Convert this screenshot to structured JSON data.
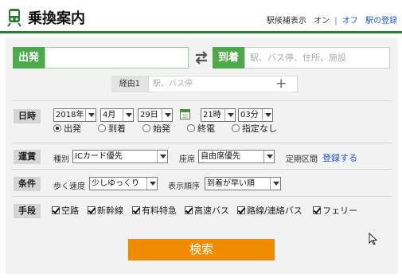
{
  "header": {
    "title": "乗換案内",
    "station_hint_label": "駅候補表示",
    "on_label": "オン",
    "separator": "|",
    "off_label": "オフ",
    "station_register_link": "駅の登録",
    "logo_icon": "train-icon",
    "accent_color": "#2e7d32"
  },
  "route": {
    "depart_label": "出発",
    "depart_value": "",
    "arrive_label": "到着",
    "arrive_placeholder": "駅、バス停、住所、施設",
    "swap_icon": "swap-arrows-icon",
    "via_label": "経由1",
    "via_placeholder": "駅、バス停",
    "add_via_icon": "plus-icon"
  },
  "datetime": {
    "label": "日時",
    "year": "2018年",
    "month": "4月",
    "day": "29日",
    "hour": "21時",
    "minute": "03分",
    "calendar_icon": "calendar-icon",
    "options": [
      "出発",
      "到着",
      "始発",
      "終電",
      "指定なし"
    ],
    "selected": "出発"
  },
  "fare": {
    "label": "運賃",
    "type_label": "種別",
    "type_value": "ICカード優先",
    "seat_label": "座席",
    "seat_value": "自由席優先",
    "commuter_label": "定期区間",
    "register_link": "登録する"
  },
  "conditions": {
    "label": "条件",
    "walk_label": "歩く速度",
    "walk_value": "少しゆっくり",
    "order_label": "表示順序",
    "order_value": "到着が早い順"
  },
  "means": {
    "label": "手段",
    "items": [
      "空路",
      "新幹線",
      "有料特急",
      "高速バス",
      "路線/連絡バス",
      "フェリー"
    ],
    "all_checked": true
  },
  "search_button": "検索",
  "colors": {
    "green_label": "#4caa4a",
    "search_button": "#f08a00",
    "link": "#1a56c4"
  }
}
